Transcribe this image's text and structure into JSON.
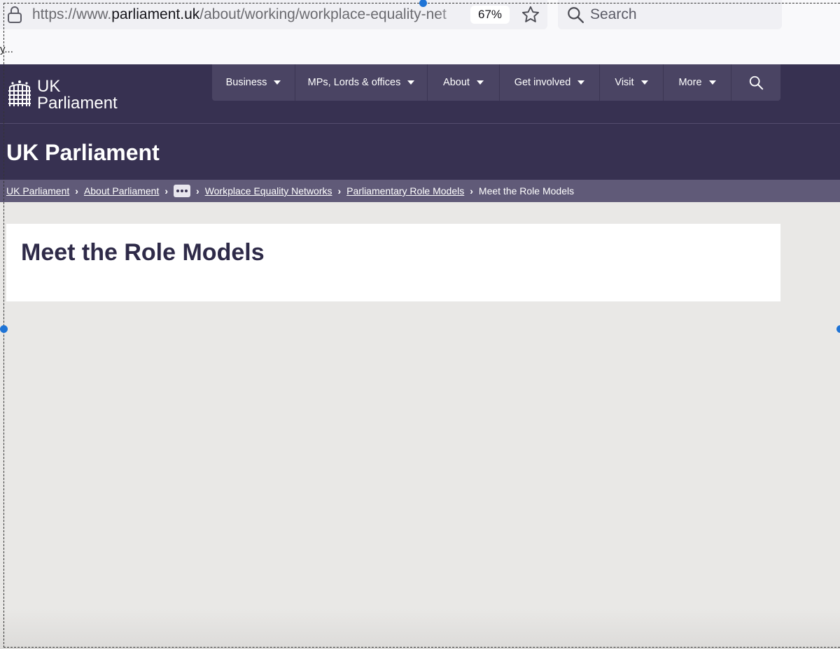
{
  "browser": {
    "url_prefix": "https://www.",
    "url_host": "parliament.uk",
    "url_path": "/about/working/workplace-equality-net",
    "zoom": "67%",
    "search_placeholder": "Search",
    "truncated_text": "y..."
  },
  "site": {
    "logo_line1": "UK",
    "logo_line2": "Parliament",
    "title": "UK Parliament"
  },
  "nav": {
    "items": [
      {
        "label": "Business"
      },
      {
        "label": "MPs, Lords & offices"
      },
      {
        "label": "About"
      },
      {
        "label": "Get involved"
      },
      {
        "label": "Visit"
      },
      {
        "label": "More"
      }
    ]
  },
  "breadcrumb": {
    "items": [
      {
        "label": "UK Parliament"
      },
      {
        "label": "About Parliament"
      },
      {
        "label": "Workplace Equality Networks"
      },
      {
        "label": "Parliamentary Role Models"
      },
      {
        "label": "Meet the Role Models"
      }
    ]
  },
  "main": {
    "heading": "Meet the Role Models"
  },
  "colors": {
    "header_bg": "#373151",
    "nav_bg": "#4a4463",
    "breadcrumb_bg": "#605a78",
    "page_bg": "#e9e8e6",
    "heading": "#2e2a48",
    "selection_handle": "#1f74d6"
  }
}
